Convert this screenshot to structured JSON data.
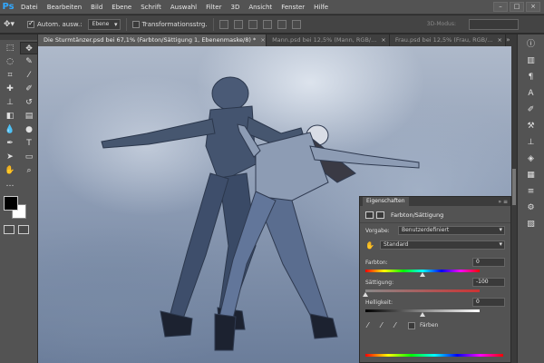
{
  "app": {
    "logo": "Ps"
  },
  "menu": [
    "Datei",
    "Bearbeiten",
    "Bild",
    "Ebene",
    "Schrift",
    "Auswahl",
    "Filter",
    "3D",
    "Ansicht",
    "Fenster",
    "Hilfe"
  ],
  "window_controls": {
    "minimize": "–",
    "maximize": "□",
    "close": "×"
  },
  "options": {
    "auto_select_label": "Autom. ausw.:",
    "auto_select_value": "Ebene",
    "transform_label": "Transformationsstrg.",
    "mode_3d": "3D-Modus:"
  },
  "tabs": [
    {
      "label": "Die Sturmtänzer.psd bei 67,1% (Farbton/Sättigung 1, Ebenenmaske/8) *",
      "close": "×"
    },
    {
      "label": "Mann.psd bei 12,5% (Mann, RGB/...",
      "close": "×"
    },
    {
      "label": "Frau.psd bei 12,5% (Frau, RGB/...",
      "close": "×"
    }
  ],
  "properties": {
    "tab": "Eigenschaften",
    "title": "Farbton/Sättigung",
    "preset_label": "Vorgabe:",
    "preset_value": "Benutzerdefiniert",
    "channel_value": "Standard",
    "hue": {
      "label": "Farbton:",
      "value": "0",
      "position": 0.5
    },
    "saturation": {
      "label": "Sättigung:",
      "value": "-100",
      "position": 0.0
    },
    "lightness": {
      "label": "Helligkeit:",
      "value": "0",
      "position": 0.5
    },
    "colorize_label": "Färben"
  },
  "colors": {
    "foreground": "#000000",
    "background": "#ffffff",
    "accent": "#31a8ff"
  }
}
